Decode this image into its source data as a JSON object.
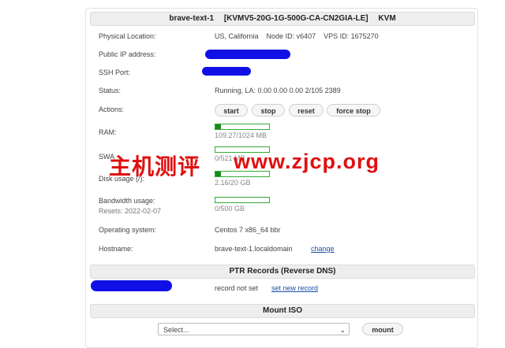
{
  "server": {
    "name": "brave-text-1",
    "plan": "[KVMV5-20G-1G-500G-CA-CN2GIA-LE]",
    "type": "KVM"
  },
  "info": {
    "location_label": "Physical Location:",
    "location_value": "US, California",
    "node_id": "Node ID: v6407",
    "vps_id": "VPS ID: 1675270",
    "ip_label": "Public IP address:",
    "ssh_label": "SSH Port:",
    "status_label": "Status:",
    "status_value": "Running, LA: 0.00 0.00 0.00 2/105 2389",
    "actions_label": "Actions:",
    "ram_label": "RAM:",
    "ram_value": "109.27/1024 MB",
    "ram_fraction": 0.107,
    "swap_label": "SWA",
    "swap_value": "0/521 MB",
    "swap_fraction": 0.0,
    "disk_label": "Disk usage (/):",
    "disk_value": "2.16/20 GB",
    "disk_fraction": 0.108,
    "bw_label": "Bandwidth usage:",
    "bw_resets": "Resets: 2022-02-07",
    "bw_value": "0/500 GB",
    "bw_fraction": 0.0,
    "os_label": "Operating system:",
    "os_value": "Centos 7 x86_64 bbr",
    "hostname_label": "Hostname:",
    "hostname_value": "brave-text-1.localdomain",
    "hostname_change": "change"
  },
  "actions": {
    "start": "start",
    "stop": "stop",
    "reset": "reset",
    "force_stop": "force stop"
  },
  "ptr": {
    "header": "PTR Records (Reverse DNS)",
    "record": "record not set",
    "set_link": "set new record"
  },
  "iso": {
    "header": "Mount ISO",
    "select_placeholder": "Select...",
    "mount_button": "mount"
  },
  "watermark": {
    "cn": "主机测评",
    "url": "www.zjcp.org"
  },
  "colors": {
    "bar_border": "#33aa33",
    "bar_fill": "#1a8a1a",
    "watermark": "#e01010",
    "redaction": "#1010e6"
  }
}
